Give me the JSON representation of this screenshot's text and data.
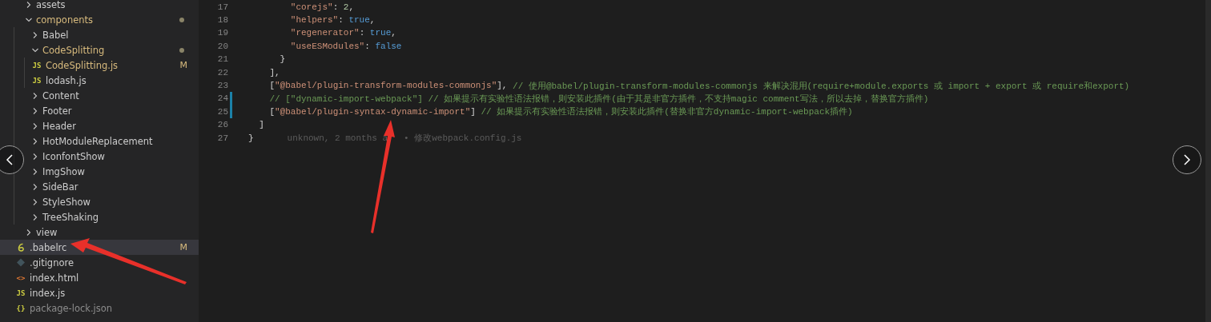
{
  "explorer": {
    "items": [
      {
        "kind": "folder",
        "label": "assets",
        "expanded": false,
        "modified": false,
        "dimmed": false,
        "selected": false
      },
      {
        "kind": "folder",
        "label": "components",
        "expanded": true,
        "modified": true,
        "dimmed": false,
        "dot": true,
        "selected": false,
        "children": [
          {
            "kind": "folder",
            "label": "Babel",
            "expanded": false,
            "modified": false,
            "dimmed": false,
            "selected": false
          },
          {
            "kind": "folder",
            "label": "CodeSplitting",
            "expanded": true,
            "modified": true,
            "dimmed": false,
            "dot": true,
            "selected": false,
            "children": [
              {
                "kind": "js",
                "glyph": "JS",
                "label": "CodeSplitting.js",
                "modified": true,
                "dimmed": false,
                "badge": "M",
                "selected": false
              },
              {
                "kind": "js",
                "glyph": "JS",
                "label": "lodash.js",
                "modified": false,
                "dimmed": false,
                "selected": false
              }
            ]
          },
          {
            "kind": "folder",
            "label": "Content",
            "expanded": false,
            "modified": false,
            "dimmed": false,
            "selected": false
          },
          {
            "kind": "folder",
            "label": "Footer",
            "expanded": false,
            "modified": false,
            "dimmed": false,
            "selected": false
          },
          {
            "kind": "folder",
            "label": "Header",
            "expanded": false,
            "modified": false,
            "dimmed": false,
            "selected": false
          },
          {
            "kind": "folder",
            "label": "HotModuleReplacement",
            "expanded": false,
            "modified": false,
            "dimmed": false,
            "selected": false
          },
          {
            "kind": "folder",
            "label": "IconfontShow",
            "expanded": false,
            "modified": false,
            "dimmed": false,
            "selected": false
          },
          {
            "kind": "folder",
            "label": "ImgShow",
            "expanded": false,
            "modified": false,
            "dimmed": false,
            "selected": false
          },
          {
            "kind": "folder",
            "label": "SideBar",
            "expanded": false,
            "modified": false,
            "dimmed": false,
            "selected": false
          },
          {
            "kind": "folder",
            "label": "StyleShow",
            "expanded": false,
            "modified": false,
            "dimmed": false,
            "selected": false
          },
          {
            "kind": "folder",
            "label": "TreeShaking",
            "expanded": false,
            "modified": false,
            "dimmed": false,
            "selected": false
          }
        ]
      },
      {
        "kind": "folder",
        "label": "view",
        "expanded": false,
        "modified": false,
        "dimmed": false,
        "selected": false
      },
      {
        "kind": "babel",
        "label": ".babelrc",
        "modified": false,
        "dimmed": false,
        "badge": "M",
        "selected": true
      },
      {
        "kind": "git",
        "label": ".gitignore",
        "modified": false,
        "dimmed": false,
        "selected": false
      },
      {
        "kind": "html",
        "glyph": "<>",
        "label": "index.html",
        "modified": false,
        "dimmed": false,
        "selected": false
      },
      {
        "kind": "js",
        "glyph": "JS",
        "label": "index.js",
        "modified": false,
        "dimmed": false,
        "selected": false
      },
      {
        "kind": "json",
        "glyph": "{}",
        "label": "package-lock.json",
        "modified": false,
        "dimmed": true,
        "selected": false
      }
    ]
  },
  "editor": {
    "lines": [
      {
        "number": "17",
        "changed": false,
        "tokens": [
          {
            "kind": "str",
            "text": "        \"corejs\""
          },
          {
            "kind": "punc",
            "text": ": "
          },
          {
            "kind": "num",
            "text": "2"
          },
          {
            "kind": "punc",
            "text": ","
          }
        ]
      },
      {
        "number": "18",
        "changed": false,
        "tokens": [
          {
            "kind": "str",
            "text": "        \"helpers\""
          },
          {
            "kind": "punc",
            "text": ": "
          },
          {
            "kind": "bool",
            "text": "true"
          },
          {
            "kind": "punc",
            "text": ","
          }
        ]
      },
      {
        "number": "19",
        "changed": false,
        "tokens": [
          {
            "kind": "str",
            "text": "        \"regenerator\""
          },
          {
            "kind": "punc",
            "text": ": "
          },
          {
            "kind": "bool",
            "text": "true"
          },
          {
            "kind": "punc",
            "text": ","
          }
        ]
      },
      {
        "number": "20",
        "changed": false,
        "tokens": [
          {
            "kind": "str",
            "text": "        \"useESModules\""
          },
          {
            "kind": "punc",
            "text": ": "
          },
          {
            "kind": "bool",
            "text": "false"
          }
        ]
      },
      {
        "number": "21",
        "changed": false,
        "tokens": [
          {
            "kind": "punc",
            "text": "      }"
          }
        ]
      },
      {
        "number": "22",
        "changed": false,
        "tokens": [
          {
            "kind": "punc",
            "text": "    ],"
          }
        ]
      },
      {
        "number": "23",
        "changed": false,
        "tokens": [
          {
            "kind": "punc",
            "text": "    ["
          },
          {
            "kind": "str",
            "text": "\"@babel/plugin-transform-modules-commonjs\""
          },
          {
            "kind": "punc",
            "text": "], "
          },
          {
            "kind": "comment",
            "text": "// 使用@babel/plugin-transform-modules-commonjs 来解决混用(require+module.exports 或 import + export 或 require和export)"
          }
        ]
      },
      {
        "number": "24",
        "changed": true,
        "tokens": [
          {
            "kind": "comment",
            "text": "    // [\"dynamic-import-webpack\"] // 如果提示有实验性语法报错，则安装此插件(由于其是非官方插件，不支持magic comment写法，所以去掉，替换官方插件)"
          }
        ]
      },
      {
        "number": "25",
        "changed": true,
        "tokens": [
          {
            "kind": "punc",
            "text": "    ["
          },
          {
            "kind": "str",
            "text": "\"@babel/plugin-syntax-dynamic-import\""
          },
          {
            "kind": "punc",
            "text": "] "
          },
          {
            "kind": "comment",
            "text": "// 如果提示有实验性语法报错，则安装此插件(替换非官方dynamic-import-webpack插件)"
          }
        ]
      },
      {
        "number": "26",
        "changed": false,
        "tokens": [
          {
            "kind": "punc",
            "text": "  ]"
          }
        ]
      },
      {
        "number": "27",
        "changed": false,
        "tokens": [
          {
            "kind": "punc",
            "text": "}"
          }
        ],
        "blame": [
          "unknown, 2 months a",
          "• 修改webpack.config.js"
        ]
      }
    ]
  }
}
